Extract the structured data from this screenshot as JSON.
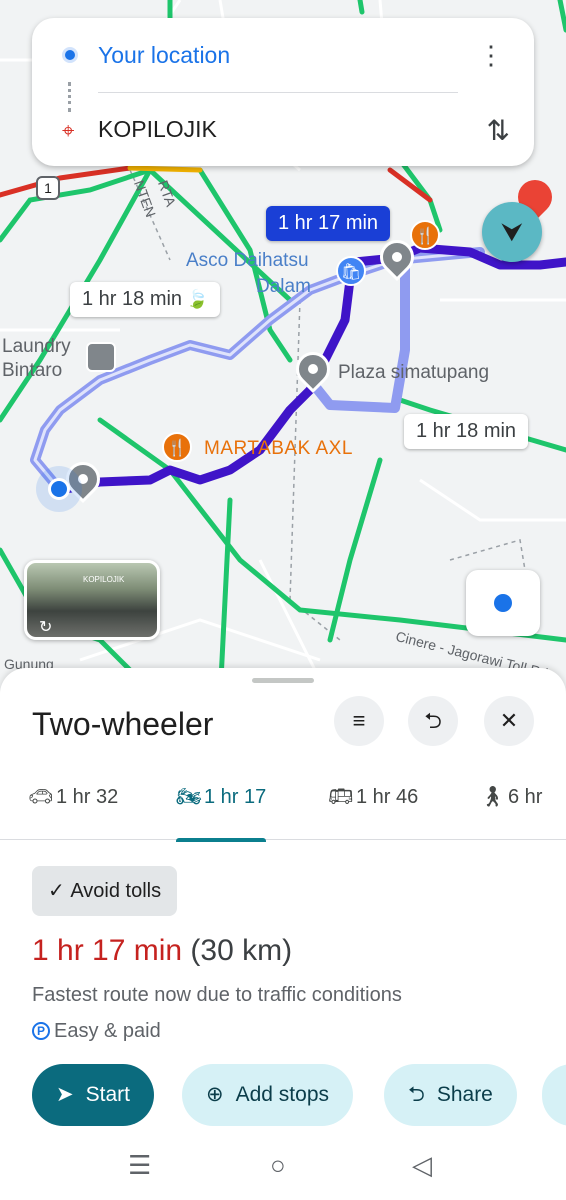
{
  "directions": {
    "origin": "Your location",
    "destination": "KOPILOJIK"
  },
  "map": {
    "route_times": {
      "selected": "1 hr 17 min",
      "alt_eco": "1 hr 18 min",
      "alt_right": "1 hr 18 min"
    },
    "places": {
      "asco": "Asco Daihatsu",
      "dalam": "Dalam",
      "laundry": "Laundry",
      "bintaro": "Bintaro",
      "plaza": "Plaza simatupang",
      "martabak": "MARTABAK AXL",
      "gunung": "Gunung",
      "toll": "Cinere - Jagorawi Toll Rd",
      "rta": "RTA",
      "nten": "NTEN",
      "road_1": "1"
    },
    "streetview_sign": "KOPILOJIK"
  },
  "sheet": {
    "title": "Two-wheeler",
    "modes": [
      {
        "label": "1 hr 32",
        "icon": "car-icon"
      },
      {
        "label": "1 hr 17",
        "icon": "motorcycle-icon"
      },
      {
        "label": "1 hr 46",
        "icon": "transit-icon"
      },
      {
        "label": "6 hr",
        "icon": "walk-icon"
      }
    ],
    "avoid_tolls": "Avoid tolls",
    "route_time": "1 hr 17 min",
    "route_distance": "(30 km)",
    "route_description": "Fastest route now due to traffic conditions",
    "parking": "Easy & paid",
    "actions": {
      "start": "Start",
      "add_stops": "Add stops",
      "share": "Share"
    }
  },
  "colors": {
    "route_selected": "#3f14c8",
    "route_alt": "#8f9bf0",
    "traffic_green": "#1ec56b",
    "traffic_red": "#d93025",
    "accent": "#0b6b7e"
  }
}
